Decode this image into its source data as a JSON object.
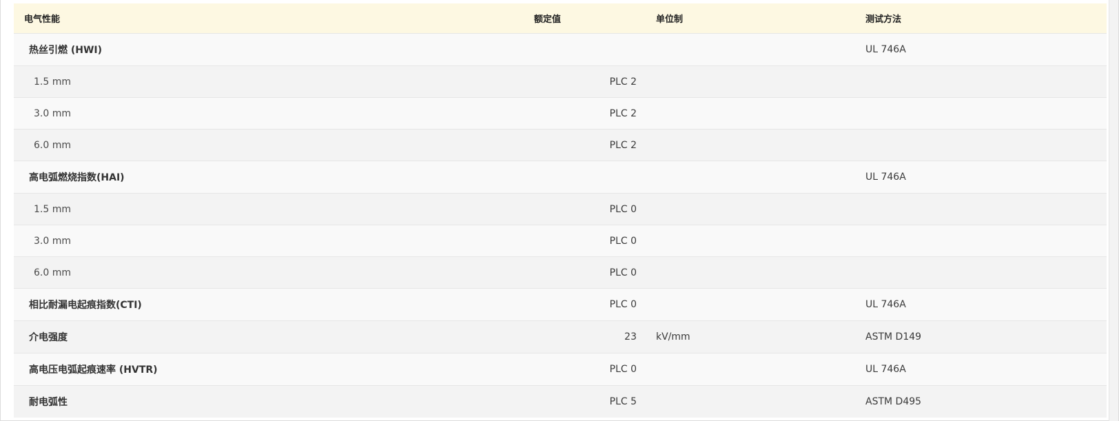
{
  "table": {
    "headers": {
      "property": "电气性能",
      "rated": "额定值",
      "unit": "单位制",
      "method": "测试方法"
    },
    "rows": [
      {
        "kind": "group",
        "property": "热丝引燃 (HWI)",
        "rated": "",
        "unit": "",
        "method": "UL 746A"
      },
      {
        "kind": "sub",
        "property": "1.5 mm",
        "rated": "PLC 2",
        "unit": "",
        "method": ""
      },
      {
        "kind": "sub",
        "property": "3.0 mm",
        "rated": "PLC 2",
        "unit": "",
        "method": ""
      },
      {
        "kind": "sub",
        "property": "6.0 mm",
        "rated": "PLC 2",
        "unit": "",
        "method": ""
      },
      {
        "kind": "group",
        "property": "高电弧燃烧指数(HAI)",
        "rated": "",
        "unit": "",
        "method": "UL 746A"
      },
      {
        "kind": "sub",
        "property": "1.5 mm",
        "rated": "PLC 0",
        "unit": "",
        "method": ""
      },
      {
        "kind": "sub",
        "property": "3.0 mm",
        "rated": "PLC 0",
        "unit": "",
        "method": ""
      },
      {
        "kind": "sub",
        "property": "6.0 mm",
        "rated": "PLC 0",
        "unit": "",
        "method": ""
      },
      {
        "kind": "group",
        "property": "相比耐漏电起痕指数(CTI)",
        "rated": "PLC 0",
        "unit": "",
        "method": "UL 746A"
      },
      {
        "kind": "group",
        "property": "介电强度",
        "rated": "23",
        "unit": "kV/mm",
        "method": "ASTM D149"
      },
      {
        "kind": "group",
        "property": "高电压电弧起痕速率 (HVTR)",
        "rated": "PLC 0",
        "unit": "",
        "method": "UL 746A"
      },
      {
        "kind": "group",
        "property": "耐电弧性",
        "rated": "PLC 5",
        "unit": "",
        "method": "ASTM D495"
      }
    ]
  }
}
